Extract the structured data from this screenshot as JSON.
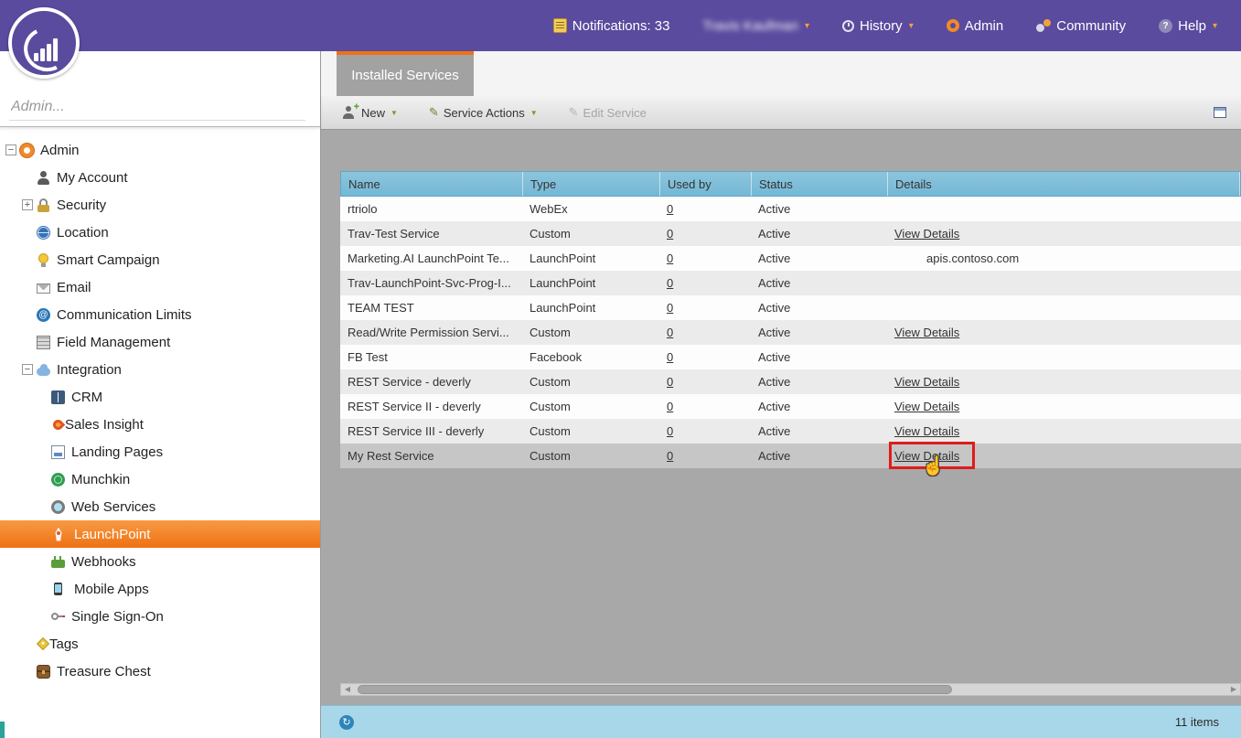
{
  "topbar": {
    "notifications_label": "Notifications: 33",
    "user_name": "Travis Kaufman",
    "history_label": "History",
    "admin_label": "Admin",
    "community_label": "Community",
    "help_label": "Help"
  },
  "sidebar": {
    "search_placeholder": "Admin...",
    "tree": [
      {
        "label": "Admin",
        "level": 0,
        "icon": "gear",
        "expander": "minus"
      },
      {
        "label": "My Account",
        "level": 1,
        "icon": "user"
      },
      {
        "label": "Security",
        "level": 1,
        "icon": "lock",
        "expander": "plus"
      },
      {
        "label": "Location",
        "level": 1,
        "icon": "globe"
      },
      {
        "label": "Smart Campaign",
        "level": 1,
        "icon": "bulb"
      },
      {
        "label": "Email",
        "level": 1,
        "icon": "env"
      },
      {
        "label": "Communication Limits",
        "level": 1,
        "icon": "at"
      },
      {
        "label": "Field Management",
        "level": 1,
        "icon": "fields"
      },
      {
        "label": "Integration",
        "level": 1,
        "icon": "cloud",
        "expander": "minus"
      },
      {
        "label": "CRM",
        "level": 2,
        "icon": "book"
      },
      {
        "label": "Sales Insight",
        "level": 2,
        "icon": "flame"
      },
      {
        "label": "Landing Pages",
        "level": 2,
        "icon": "pages"
      },
      {
        "label": "Munchkin",
        "level": 2,
        "icon": "munchkin"
      },
      {
        "label": "Web Services",
        "level": 2,
        "icon": "websvc"
      },
      {
        "label": "LaunchPoint",
        "level": 2,
        "icon": "rocket",
        "selected": true
      },
      {
        "label": "Webhooks",
        "level": 2,
        "icon": "webhook"
      },
      {
        "label": "Mobile Apps",
        "level": 2,
        "icon": "mobile"
      },
      {
        "label": "Single Sign-On",
        "level": 2,
        "icon": "key"
      },
      {
        "label": "Tags",
        "level": 1,
        "icon": "tag"
      },
      {
        "label": "Treasure Chest",
        "level": 1,
        "icon": "chest"
      }
    ]
  },
  "main": {
    "tab_label": "Installed Services",
    "toolbar": {
      "new_label": "New",
      "service_actions_label": "Service Actions",
      "edit_service_label": "Edit Service"
    },
    "table": {
      "columns": [
        "Name",
        "Type",
        "Used by",
        "Status",
        "Details"
      ],
      "rows": [
        {
          "name": "rtriolo",
          "type": "WebEx",
          "used_by": "0",
          "status": "Active",
          "details": "",
          "details_type": "none"
        },
        {
          "name": "Trav-Test Service",
          "type": "Custom",
          "used_by": "0",
          "status": "Active",
          "details": "View Details",
          "details_type": "link"
        },
        {
          "name": "Marketing.AI LaunchPoint Te...",
          "type": "LaunchPoint",
          "used_by": "0",
          "status": "Active",
          "details": "apis.contoso.com",
          "details_type": "text"
        },
        {
          "name": "Trav-LaunchPoint-Svc-Prog-I...",
          "type": "LaunchPoint",
          "used_by": "0",
          "status": "Active",
          "details": "",
          "details_type": "none"
        },
        {
          "name": "TEAM TEST",
          "type": "LaunchPoint",
          "used_by": "0",
          "status": "Active",
          "details": "",
          "details_type": "none"
        },
        {
          "name": "Read/Write Permission Servi...",
          "type": "Custom",
          "used_by": "0",
          "status": "Active",
          "details": "View Details",
          "details_type": "link"
        },
        {
          "name": "FB Test",
          "type": "Facebook",
          "used_by": "0",
          "status": "Active",
          "details": "",
          "details_type": "none"
        },
        {
          "name": "REST Service - deverly",
          "type": "Custom",
          "used_by": "0",
          "status": "Active",
          "details": "View Details",
          "details_type": "link"
        },
        {
          "name": "REST Service II - deverly",
          "type": "Custom",
          "used_by": "0",
          "status": "Active",
          "details": "View Details",
          "details_type": "link"
        },
        {
          "name": "REST Service III - deverly",
          "type": "Custom",
          "used_by": "0",
          "status": "Active",
          "details": "View Details",
          "details_type": "link"
        },
        {
          "name": "My Rest Service",
          "type": "Custom",
          "used_by": "0",
          "status": "Active",
          "details": "View Details",
          "details_type": "link",
          "selected": true,
          "annotated": true
        }
      ]
    },
    "footer": {
      "items_label": "11 items"
    }
  },
  "annotation": {
    "type": "highlight-box",
    "target": "View Details link of My Rest Service row",
    "color": "#de1c1c",
    "cursor": "hand-pointer"
  },
  "colors": {
    "brand_purple": "#5a4b9e",
    "brand_orange": "#ee7113",
    "table_header_blue": "#7cc0dc",
    "footer_blue": "#a9d7ea",
    "selected_row_gray": "#c6c6c6",
    "annotation_red": "#de1c1c"
  }
}
